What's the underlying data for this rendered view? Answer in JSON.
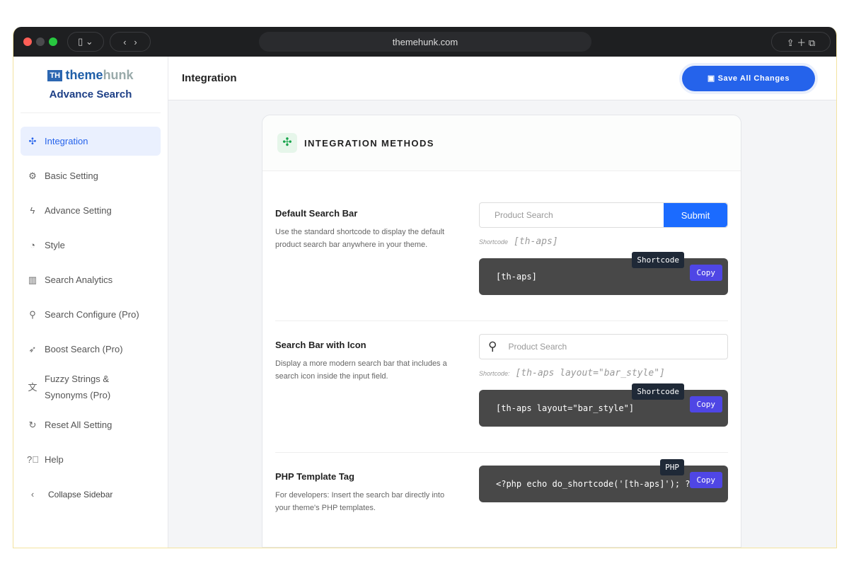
{
  "browser": {
    "url": "themehunk.com"
  },
  "sidebar": {
    "logo_text": "themehunk",
    "logo_mark": "TH",
    "subtitle": "Advance Search",
    "items": [
      {
        "label": "Integration",
        "icon": "puzzle-icon"
      },
      {
        "label": "Basic Setting",
        "icon": "gear-icon"
      },
      {
        "label": "Advance Setting",
        "icon": "bolt-icon"
      },
      {
        "label": "Style",
        "icon": "palette-icon"
      },
      {
        "label": "Search Analytics",
        "icon": "chart-icon"
      },
      {
        "label": "Search Configure (Pro)",
        "icon": "search-icon"
      },
      {
        "label": "Boost Search (Pro)",
        "icon": "rocket-icon"
      },
      {
        "label": "Fuzzy Strings & Synonyms (Pro)",
        "icon": "translate-icon"
      },
      {
        "label": "Reset All Setting",
        "icon": "reset-icon"
      },
      {
        "label": "Help",
        "icon": "help-icon"
      },
      {
        "label": "Collapse Sidebar",
        "icon": "chevron-left-icon"
      }
    ]
  },
  "header": {
    "title": "Integration",
    "save_label": "Save All Changes"
  },
  "card": {
    "title": "INTEGRATION METHODS",
    "sections": [
      {
        "title": "Default Search Bar",
        "desc": "Use the standard shortcode to display the default product search bar anywhere in your theme.",
        "placeholder": "Product Search",
        "submit": "Submit",
        "sc_label": "Shortcode",
        "sc_value": "[th-aps]",
        "code": "[th-aps]",
        "tip": "Shortcode",
        "copy": "Copy"
      },
      {
        "title": "Search Bar with Icon",
        "desc": "Display a more modern search bar that includes a search icon inside the input field.",
        "placeholder": "Product Search",
        "sc_label": "Shortcode:",
        "sc_value": "[th-aps layout=\"bar_style\"]",
        "code": "[th-aps layout=\"bar_style\"]",
        "tip": "Shortcode",
        "copy": "Copy"
      },
      {
        "title": "PHP Template Tag",
        "desc": "For developers: Insert the search bar directly into your theme's PHP templates.",
        "code": "<?php echo do_shortcode('[th-aps]'); ?>",
        "tip": "PHP",
        "copy": "Copy"
      }
    ]
  }
}
